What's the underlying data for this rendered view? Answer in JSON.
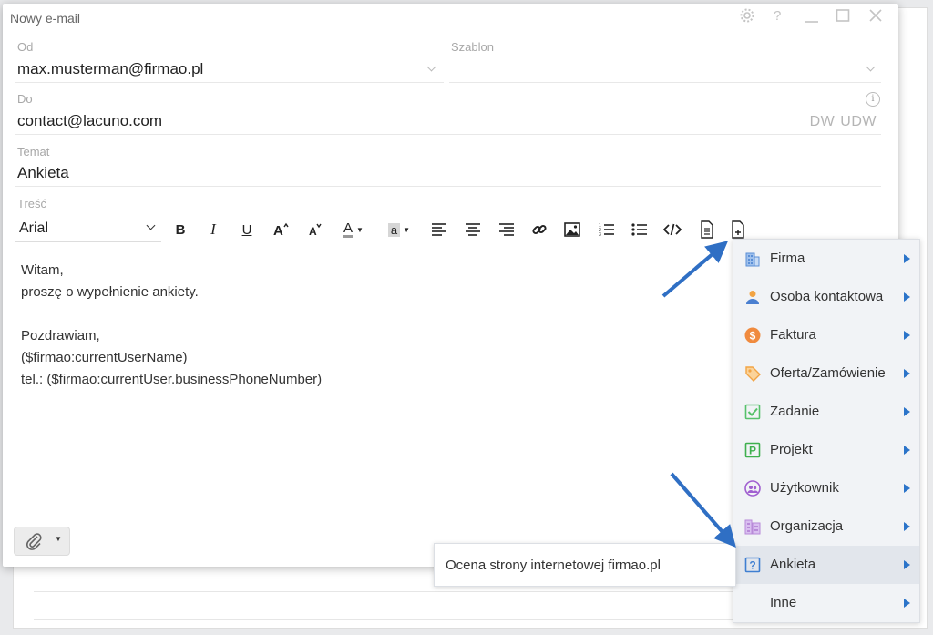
{
  "dialog": {
    "title": "Nowy e-mail",
    "controls": [
      "gear-icon",
      "help-icon",
      "minimize-icon",
      "maximize-icon",
      "close-icon"
    ],
    "help_glyph": "?"
  },
  "form": {
    "from_label": "Od",
    "from_value": "max.musterman@firmao.pl",
    "template_label": "Szablon",
    "template_value": "",
    "to_label": "Do",
    "to_value": "contact@lacuno.com",
    "cc_label": "DW",
    "bcc_label": "UDW",
    "info_glyph": "i",
    "subject_label": "Temat",
    "subject_value": "Ankieta",
    "body_label": "Treść"
  },
  "toolbar": {
    "font_name": "Arial",
    "bold": "B",
    "italic": "I",
    "underline": "U",
    "text_color_letter": "A",
    "bg_color_letter": "a"
  },
  "editor": {
    "lines": [
      "Witam,",
      "proszę o wypełnienie ankiety.",
      "",
      "Pozdrawiam,",
      "($firmao:currentUserName)",
      "tel.: ($firmao:currentUser.businessPhoneNumber)"
    ]
  },
  "insert_menu": {
    "items": [
      {
        "label": "Firma",
        "icon": "building-icon",
        "color": "#5b8fd6"
      },
      {
        "label": "Osoba kontaktowa",
        "icon": "contact-person-icon",
        "color": "#4a7fd0"
      },
      {
        "label": "Faktura",
        "icon": "invoice-dollar-icon",
        "color": "#f08a3e"
      },
      {
        "label": "Oferta/Zamówienie",
        "icon": "offer-tag-icon",
        "color": "#f2a444"
      },
      {
        "label": "Zadanie",
        "icon": "task-check-icon",
        "color": "#56c16a"
      },
      {
        "label": "Projekt",
        "icon": "project-p-icon",
        "color": "#3fb04e"
      },
      {
        "label": "Użytkownik",
        "icon": "user-group-icon",
        "color": "#a05fd0"
      },
      {
        "label": "Organizacja",
        "icon": "organization-icon",
        "color": "#b88ad8"
      },
      {
        "label": "Ankieta",
        "icon": "survey-question-icon",
        "color": "#3f7fd1"
      },
      {
        "label": "Inne",
        "icon": "",
        "color": ""
      }
    ]
  },
  "survey_submenu": {
    "items": [
      "Ocena strony internetowej firmao.pl"
    ]
  }
}
